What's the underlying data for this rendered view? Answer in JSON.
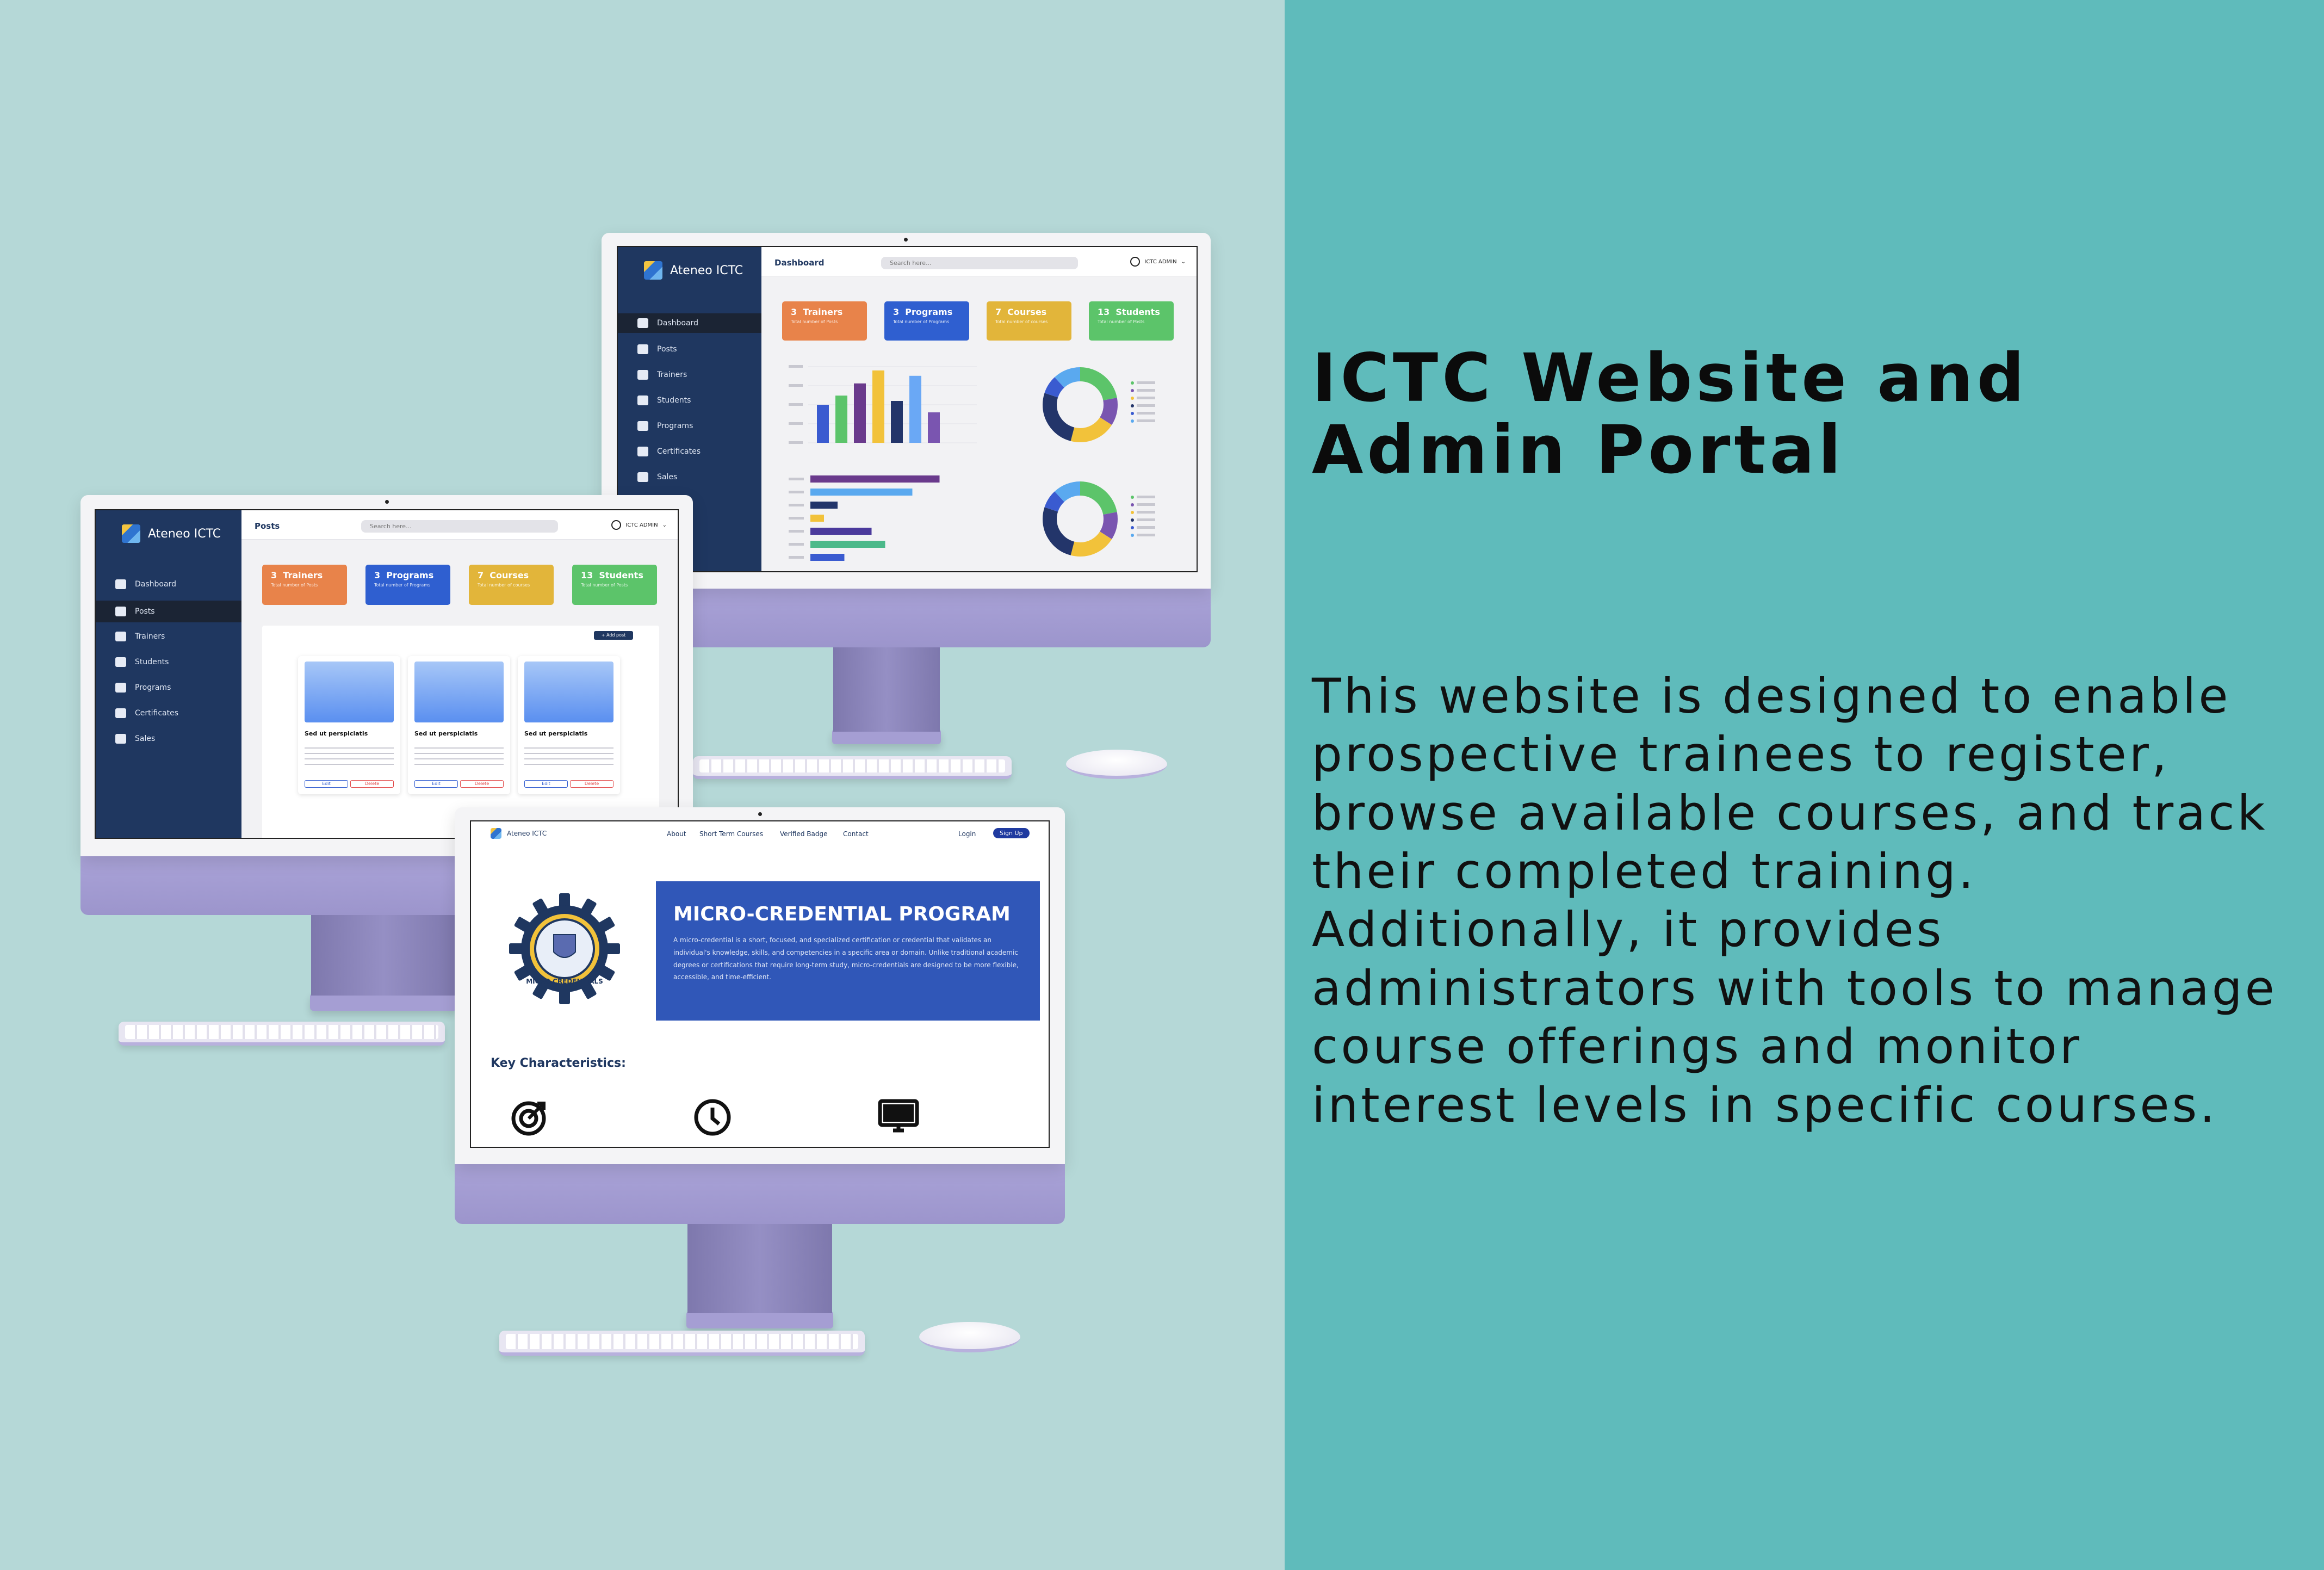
{
  "headline": "ICTC Website and Admin Portal",
  "description": "This website is designed to enable prospective trainees to register, browse available courses, and track their completed training. Additionally, it provides administrators with tools to manage course offerings and monitor interest levels in specific courses.",
  "colors": {
    "left_bg": "#b5d8d7",
    "right_bg": "#5fbbbb",
    "sidebar": "#1f3760",
    "trainers": "#e8834a",
    "programs": "#2f5fd0",
    "courses": "#e2b53a",
    "students": "#5cc46a"
  },
  "admin": {
    "brand": "Ateneo ICTC",
    "search_placeholder": "Search here...",
    "user": "ICTC ADMIN",
    "nav": [
      {
        "label": "Dashboard",
        "icon": "home-icon"
      },
      {
        "label": "Posts",
        "icon": "posts-icon"
      },
      {
        "label": "Trainers",
        "icon": "user-icon"
      },
      {
        "label": "Students",
        "icon": "users-icon"
      },
      {
        "label": "Programs",
        "icon": "grid-icon"
      },
      {
        "label": "Certificates",
        "icon": "certificate-icon"
      },
      {
        "label": "Sales",
        "icon": "sales-icon"
      }
    ]
  },
  "dashboard": {
    "title": "Dashboard",
    "stats": [
      {
        "num": "3",
        "label": "Trainers",
        "sub": "Total number of Posts"
      },
      {
        "num": "3",
        "label": "Programs",
        "sub": "Total number of Programs"
      },
      {
        "num": "7",
        "label": "Courses",
        "sub": "Total number of courses"
      },
      {
        "num": "13",
        "label": "Students",
        "sub": "Total number of Posts"
      }
    ]
  },
  "posts": {
    "title": "Posts",
    "add_label": "+ Add post",
    "stats": [
      {
        "num": "3",
        "label": "Trainers",
        "sub": "Total number of Posts"
      },
      {
        "num": "3",
        "label": "Programs",
        "sub": "Total number of Programs"
      },
      {
        "num": "7",
        "label": "Courses",
        "sub": "Total number of courses"
      },
      {
        "num": "13",
        "label": "Students",
        "sub": "Total number of Posts"
      }
    ],
    "cards": [
      {
        "title": "Sed ut perspiciatis",
        "edit": "Edit",
        "delete": "Delete"
      },
      {
        "title": "Sed ut perspiciatis",
        "edit": "Edit",
        "delete": "Delete"
      },
      {
        "title": "Sed ut perspiciatis",
        "edit": "Edit",
        "delete": "Delete"
      }
    ]
  },
  "website": {
    "brand": "Ateneo ICTC",
    "nav": [
      "About",
      "Short Term Courses",
      "Verified Badge",
      "Contact"
    ],
    "login": "Login",
    "signup": "Sign Up",
    "hero_title": "MICRO-CREDENTIAL PROGRAM",
    "hero_text": "A micro-credential is a short, focused, and specialized certification or credential that validates an individual's knowledge, skills, and competencies in a specific area or domain. Unlike traditional academic degrees or certifications that require long-term study, micro-credentials are designed to be more flexible, accessible, and time-efficient.",
    "badge_text": "MICRO CREDENTIALS",
    "key_title": "Key Characteristics:",
    "key_icons": [
      "target-icon",
      "clock-icon",
      "monitor-icon"
    ]
  },
  "bar_chart": [
    0.5,
    0.62,
    0.78,
    0.95,
    0.55,
    0.88,
    0.4
  ],
  "bar_colors": [
    "#3a5bd0",
    "#5cc46a",
    "#6a3a8c",
    "#f2c23a",
    "#23356a",
    "#6aa8f5",
    "#7a55b0"
  ],
  "hbar_chart": [
    0.95,
    0.75,
    0.2,
    0.1,
    0.45,
    0.55,
    0.25
  ],
  "hbar_colors": [
    "#6a3a8c",
    "#5aa9ef",
    "#23356a",
    "#f2c23a",
    "#4b3a9c",
    "#4cb98a",
    "#3a5bd0"
  ],
  "donut": [
    {
      "v": 0.22,
      "c": "#5cc46a"
    },
    {
      "v": 0.12,
      "c": "#7a55b0"
    },
    {
      "v": 0.2,
      "c": "#f2c23a"
    },
    {
      "v": 0.26,
      "c": "#23356a"
    },
    {
      "v": 0.08,
      "c": "#3a5bd0"
    },
    {
      "v": 0.12,
      "c": "#5aa9ef"
    }
  ]
}
